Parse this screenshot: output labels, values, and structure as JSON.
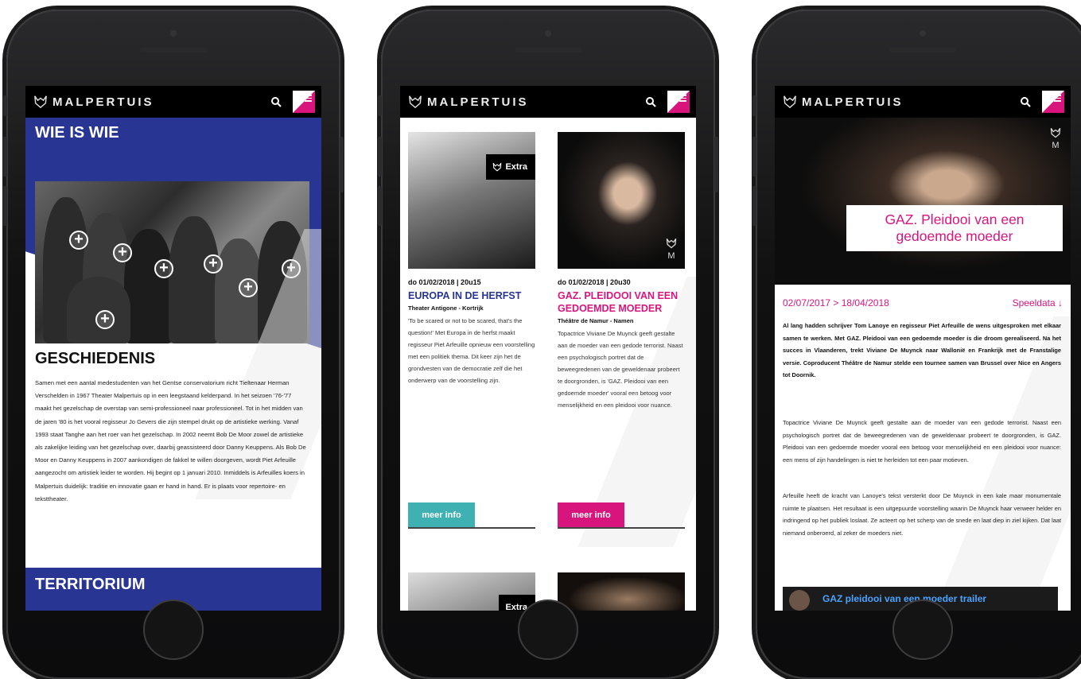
{
  "brand": {
    "name": "MALPERTUIS",
    "accent": "#d8157d",
    "blue": "#283593",
    "teal": "#3fb1b3"
  },
  "phone1": {
    "title": "WIE IS WIE",
    "section_title": "GESCHIEDENIS",
    "body": "Samen met een aantal medestudenten van het Gentse conservatorium richt Tieltenaar Herman Verschelden in 1967 Theater Malpertuis op in een leegstaand kelderpand. In het seizoen '76-'77 maakt het gezelschap de overstap van semi-professioneel naar professioneel. Tot in het midden van de jaren '80 is het vooral regisseur Jo Gevers die zijn stempel drukt op de artistieke werking. Vanaf 1993 staat Tanghe aan het roer van het gezelschap. In 2002 neemt Bob De Moor zowel de artistieke als zakelijke leiding van het gezelschap over, daarbij geassisteerd door Danny Keuppens. Als Bob De Moor en Danny Keuppens in 2007 aankondigen de fakkel te willen doorgeven, wordt Piet Arfeuille aangezocht om artistiek leider te worden. Hij begint op 1 januari 2010. Inmiddels is Arfeuilles koers in Malpertuis duidelijk: traditie en innovatie gaan er hand in hand. Er is plaats voor repertoire- en teksttheater.",
    "next_section": "TERRITORIUM",
    "plus_glyph": "+"
  },
  "phone2": {
    "cards": [
      {
        "tag": "Extra",
        "date": "do 01/02/2018 | 20u15",
        "title": "EUROPA IN DE HERFST",
        "venue": "Theater Antigone - Kortrijk",
        "desc": "'To be scared or not to be scared, that's the question!' Met Europa in de herfst maakt regisseur Piet Arfeuille opnieuw een voorstelling met een politiek thema. Dit keer zijn het de grondvesten van de democratie zelf die het onderwerp van de voorstelling zijn.",
        "button": "meer info",
        "title_color": "#283593",
        "button_color": "#3fb1b3"
      },
      {
        "tag": "M",
        "date": "do 01/02/2018 | 20u30",
        "title": "GAZ. PLEIDOOI VAN EEN GEDOEMDE MOEDER",
        "venue": "Théâtre de Namur - Namen",
        "desc": "Topactrice Viviane De Muynck geeft gestalte aan de moeder van een gedode terrorist. Naast een psychologisch portret dat de beweegredenen van de geweldenaar probeert te doorgronden, is 'GAZ. Pleidooi van een gedoemde moeder' vooral een betoog voor menselijkheid en een pleidooi voor nuance.",
        "button": "meer info",
        "title_color": "#d8157d",
        "button_color": "#d8157d"
      }
    ],
    "next_tag": "Extra"
  },
  "phone3": {
    "hero_title": "GAZ. Pleidooi van een gedoemde moeder",
    "hero_mark": "M",
    "dates": "02/07/2017 > 18/04/2018",
    "speeldata": "Speeldata",
    "lead": "Al lang hadden schrijver Tom Lanoye en regisseur Piet Arfeuille de wens uitgesproken met elkaar samen te werken. Met GAZ. Pleidooi van een gedoemde moeder is die droom gerealiseerd. Na het succes in Vlaanderen, trekt Viviane De Muynck naar Wallonië en Frankrijk met de Franstalige versie. Coproducent Théâtre de Namur stelde een tournee samen van Brussel over Nice en Angers tot Doornik.",
    "p1": "Topactrice Viviane De Muynck geeft gestalte aan de moeder van een gedode terrorist. Naast een psychologisch portret dat de beweegredenen van de geweldenaar probeert te doorgronden, is GAZ. Pleidooi van een gedoemde moeder vooral een betoog voor menselijkheid en een pleidooi voor nuance: een mens of zijn handelingen is niet te herleiden tot een paar motieven.",
    "p2": "Arfeuille heeft de kracht van Lanoye's tekst versterkt door De Muynck in een kale maar monumentale ruimte te plaatsen. Het resultaat is een uitgepuurde voorstelling waarin De Muynck haar verweer helder en indringend op het publiek loslaat. Ze acteert op het scherp van de snede en laat diep in ziel kijken. Dat laat niemand onberoerd, al zeker de moeders niet.",
    "video_title": "GAZ pleidooi van een moeder trailer"
  }
}
